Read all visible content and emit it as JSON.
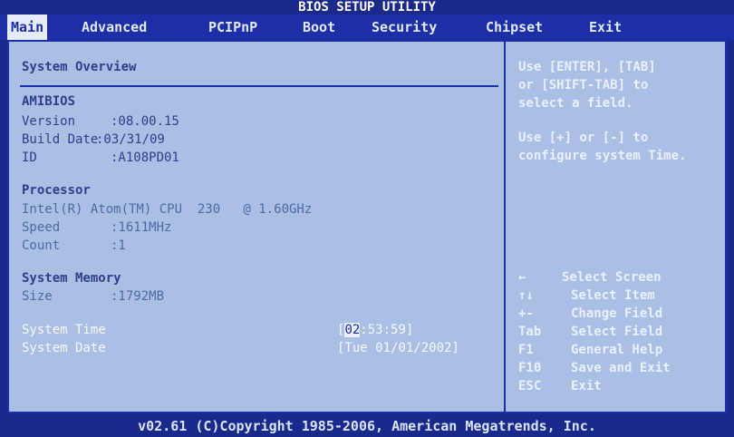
{
  "window": {
    "title": "BIOS SETUP UTILITY"
  },
  "menu": {
    "items": [
      {
        "label": "Main"
      },
      {
        "label": "Advanced"
      },
      {
        "label": "PCIPnP"
      },
      {
        "label": "Boot"
      },
      {
        "label": "Security"
      },
      {
        "label": "Chipset"
      },
      {
        "label": "Exit"
      }
    ]
  },
  "main": {
    "section_title": "System Overview",
    "amibios": {
      "title": "AMIBIOS",
      "version_label": "Version",
      "version_value": ":08.00.15",
      "build_date_label": "Build Date",
      "build_date_value": ":03/31/09",
      "id_label": "ID",
      "id_value": ":A108PD01"
    },
    "processor": {
      "title": "Processor",
      "model": "Intel(R) Atom(TM) CPU  230   @ 1.60GHz",
      "speed_label": "Speed",
      "speed_value": ":1611MHz",
      "count_label": "Count",
      "count_value": ":1"
    },
    "memory": {
      "title": "System Memory",
      "size_label": "Size",
      "size_value": ":1792MB"
    },
    "time": {
      "label": "System Time",
      "value_open": "[",
      "value_cursor": "02",
      "value_rest": ":53:59]"
    },
    "date": {
      "label": "System Date",
      "value": "[Tue 01/01/2002]"
    }
  },
  "help": {
    "line1": "Use [ENTER], [TAB]",
    "line2": "or [SHIFT-TAB] to",
    "line3": "select a field.",
    "line4": "Use [+] or [-] to",
    "line5": "configure system Time."
  },
  "keys": [
    {
      "key": "←",
      "desc": "Select Screen"
    },
    {
      "key": "↑↓",
      "desc": "Select Item"
    },
    {
      "key": "+-",
      "desc": "Change Field"
    },
    {
      "key": "Tab",
      "desc": "Select Field"
    },
    {
      "key": "F1",
      "desc": "General Help"
    },
    {
      "key": "F10",
      "desc": "Save and Exit"
    },
    {
      "key": "ESC",
      "desc": "Exit"
    }
  ],
  "footer": {
    "text": "v02.61 (C)Copyright 1985-2006, American Megatrends, Inc."
  }
}
